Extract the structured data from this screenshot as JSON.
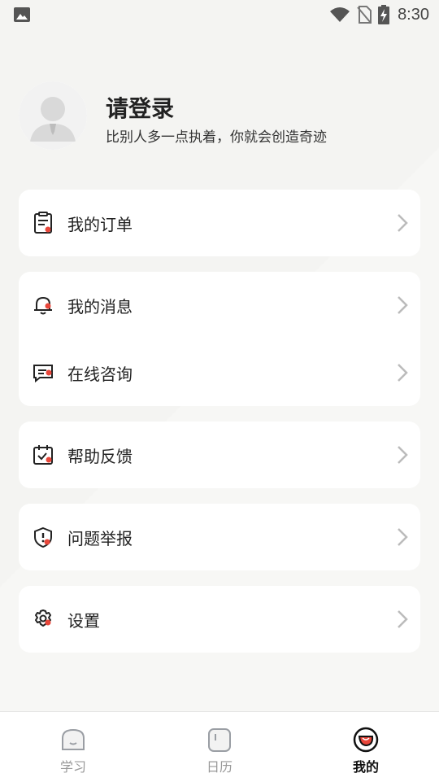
{
  "status_bar": {
    "time": "8:30"
  },
  "profile": {
    "title": "请登录",
    "subtitle": "比别人多一点执着，你就会创造奇迹"
  },
  "menu": {
    "orders": "我的订单",
    "messages": "我的消息",
    "consult": "在线咨询",
    "feedback": "帮助反馈",
    "report": "问题举报",
    "settings": "设置"
  },
  "tabs": [
    {
      "label": "学习",
      "icon": "home-icon",
      "active": false
    },
    {
      "label": "日历",
      "icon": "calendar-icon",
      "active": false
    },
    {
      "label": "我的",
      "icon": "profile-icon",
      "active": true
    }
  ],
  "colors": {
    "accent": "#e8463a",
    "background": "#f3f3f1"
  }
}
